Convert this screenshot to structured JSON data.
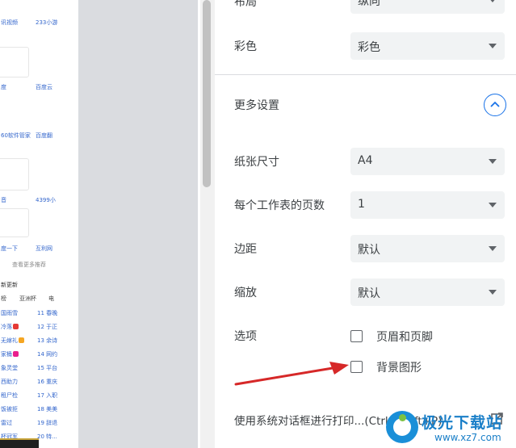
{
  "preview": {
    "items": {
      "r1a": "讯视频",
      "r1b": "233小游",
      "r2a": "度",
      "r2b": "百度云",
      "r3a": "60软件管家",
      "r3b": "百度翻",
      "r4a": "音",
      "r4b": "4399小",
      "r5a": "度一下",
      "r5b": "互利网"
    },
    "see_more": "查看更多推荐",
    "updates_heading": "新更新",
    "tabs": [
      "榜",
      "亚洲杯",
      "电"
    ],
    "list_left": [
      "国雨雪",
      "冷落",
      "无嫁礼",
      "家桶",
      "象灵堂",
      "西助力",
      "租尸检",
      "饭被拒",
      "雷过",
      "杯冠军"
    ],
    "list_right": [
      "11 春晚",
      "12 于正",
      "13 余诗",
      "14 网约",
      "15 平台",
      "16 重庆",
      "17 入职",
      "18 美美",
      "19 辞退",
      "20 特..."
    ],
    "badge_colors": [
      "#e53935",
      "#f5a623",
      "#e91e8c"
    ]
  },
  "settings": {
    "layout": {
      "label": "布局",
      "value": "纵向"
    },
    "color": {
      "label": "彩色",
      "value": "彩色"
    },
    "more_settings": "更多设置",
    "paper_size": {
      "label": "纸张尺寸",
      "value": "A4"
    },
    "pages_per_sheet": {
      "label": "每个工作表的页数",
      "value": "1"
    },
    "margins": {
      "label": "边距",
      "value": "默认"
    },
    "scale": {
      "label": "缩放",
      "value": "默认"
    },
    "options": {
      "label": "选项",
      "headers_footers": "页眉和页脚",
      "background_graphics": "背景图形"
    },
    "system_dialog": "使用系统对话框进行打印...(Ctrl+Shift+P)"
  },
  "colors": {
    "accent": "#1a73e8",
    "arrow": "#d62828",
    "select_bg": "#f1f3f4"
  },
  "watermark": {
    "title": "极光下载站",
    "url": "www.xz7.com"
  }
}
